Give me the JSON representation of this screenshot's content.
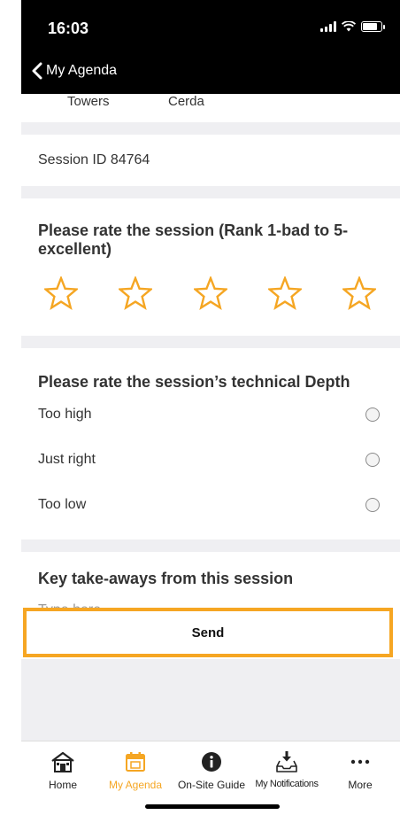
{
  "status_bar": {
    "time": "16:03"
  },
  "nav": {
    "back_label": "My Agenda"
  },
  "speakers": [
    "Towers",
    "Cerda"
  ],
  "session": {
    "id_text": "Session ID 84764"
  },
  "rating": {
    "question": "Please rate the session (Rank 1-bad to 5-excellent)",
    "star_count": 5,
    "star_color": "#f5a623",
    "selected": 0
  },
  "depth": {
    "question": "Please rate the session’s technical Depth",
    "options": [
      {
        "label": "Too high"
      },
      {
        "label": "Just right"
      },
      {
        "label": "Too low"
      }
    ]
  },
  "takeaways": {
    "question": "Key take-aways from this session",
    "placeholder": "Type here...",
    "value": ""
  },
  "send": {
    "label": "Send",
    "highlight_color": "#f6a623"
  },
  "tabs": [
    {
      "label": "Home",
      "icon": "home-icon",
      "active": false
    },
    {
      "label": "My Agenda",
      "icon": "calendar-icon",
      "active": true
    },
    {
      "label": "On-Site Guide",
      "icon": "info-icon",
      "active": false
    },
    {
      "label": "My Notifications",
      "icon": "inbox-download-icon",
      "active": false
    },
    {
      "label": "More",
      "icon": "more-icon",
      "active": false
    }
  ]
}
